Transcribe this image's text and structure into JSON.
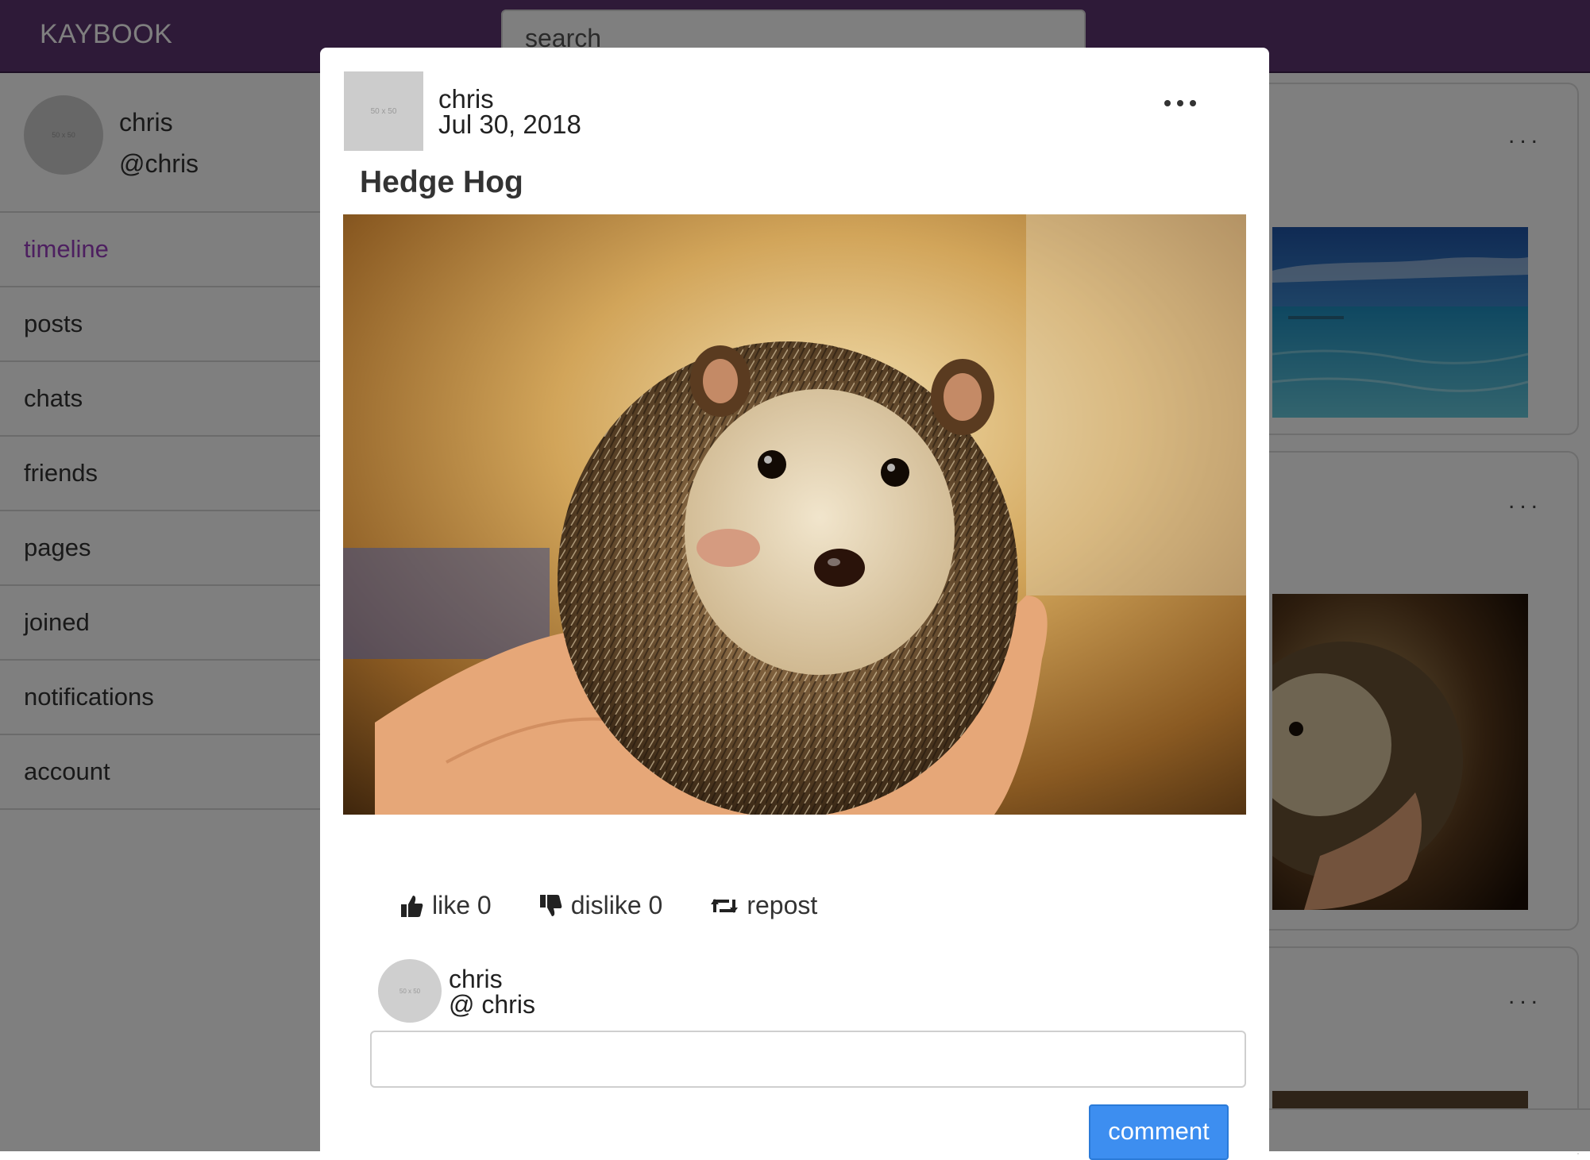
{
  "app": {
    "brand": "KAYBOOK",
    "search_value": "search"
  },
  "sidebar": {
    "profile": {
      "name": "chris",
      "handle": "@chris",
      "avatar_placeholder": "50 x 50"
    },
    "items": [
      {
        "label": "timeline",
        "active": true
      },
      {
        "label": "posts"
      },
      {
        "label": "chats"
      },
      {
        "label": "friends"
      },
      {
        "label": "pages"
      },
      {
        "label": "joined"
      },
      {
        "label": "notifications"
      },
      {
        "label": "account"
      }
    ]
  },
  "feed": {
    "card_menu": "...",
    "images": [
      "sea-image",
      "hedgehog-image"
    ]
  },
  "modal": {
    "author": "chris",
    "date": "Jul 30, 2018",
    "avatar_placeholder": "50 x 50",
    "title": "Hedge Hog",
    "image": "hedgehog-photo",
    "actions": {
      "like": "like 0",
      "dislike": "dislike 0",
      "repost": "repost"
    },
    "comment": {
      "name": "chris",
      "handle": "@ chris",
      "avatar_placeholder": "50 x 50",
      "input_value": "",
      "button": "comment"
    }
  },
  "colors": {
    "topbar": "#5c3470",
    "active_nav": "#9b3fc0",
    "comment_button": "#3d8ef0"
  }
}
